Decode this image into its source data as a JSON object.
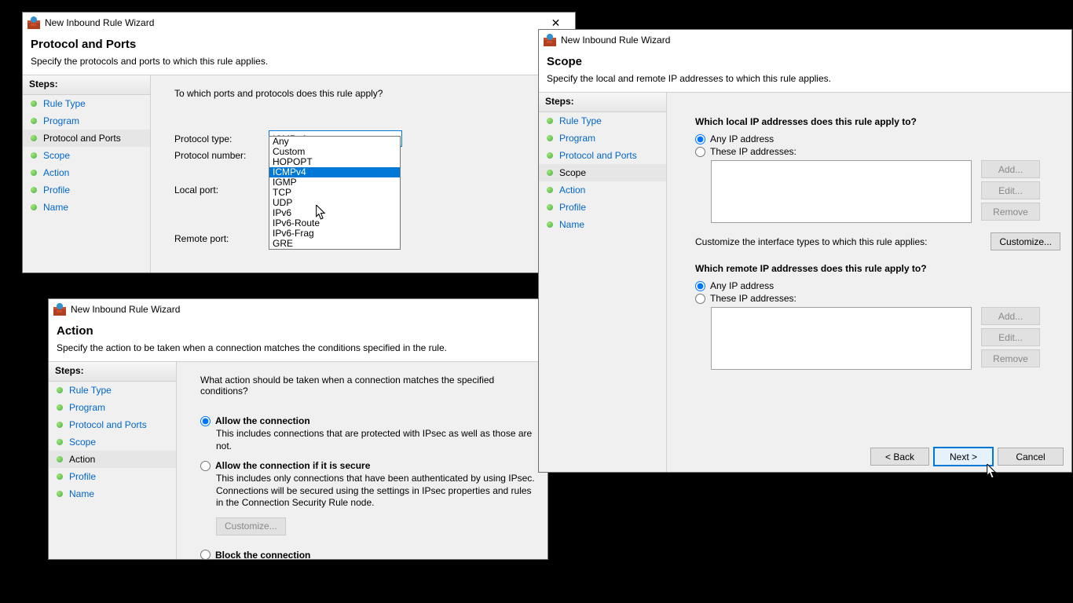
{
  "wizard_title": "New Inbound Rule Wizard",
  "steps_header": "Steps:",
  "steps": [
    "Rule Type",
    "Program",
    "Protocol and Ports",
    "Scope",
    "Action",
    "Profile",
    "Name"
  ],
  "win1": {
    "page_title": "Protocol and Ports",
    "page_subtitle": "Specify the protocols and ports to which this rule applies.",
    "current_step": "Protocol and Ports",
    "prompt": "To which ports and protocols does this rule apply?",
    "protocol_type_label": "Protocol type:",
    "protocol_type_value": "ICMPv4",
    "protocol_number_label": "Protocol number:",
    "local_port_label": "Local port:",
    "remote_port_label": "Remote port:",
    "dropdown_options": [
      "Any",
      "Custom",
      "HOPOPT",
      "ICMPv4",
      "IGMP",
      "TCP",
      "UDP",
      "IPv6",
      "IPv6-Route",
      "IPv6-Frag",
      "GRE"
    ],
    "dropdown_highlight": "ICMPv4"
  },
  "win2": {
    "page_title": "Action",
    "page_subtitle": "Specify the action to be taken when a connection matches the conditions specified in the rule.",
    "current_step": "Action",
    "prompt": "What action should be taken when a connection matches the specified conditions?",
    "opt_allow": "Allow the connection",
    "opt_allow_desc": "This includes connections that are protected with IPsec as well as those are not.",
    "opt_secure": "Allow the connection if it is secure",
    "opt_secure_desc": "This includes only connections that have been authenticated by using IPsec. Connections will be secured using the settings in IPsec properties and rules in the Connection Security Rule node.",
    "customize": "Customize...",
    "opt_block": "Block the connection"
  },
  "win3": {
    "page_title": "Scope",
    "page_subtitle": "Specify the local and remote IP addresses to which this rule applies.",
    "current_step": "Scope",
    "local_prompt": "Which local IP addresses does this rule apply to?",
    "remote_prompt": "Which remote IP addresses does this rule apply to?",
    "opt_any": "Any IP address",
    "opt_these": "These IP addresses:",
    "add": "Add...",
    "edit": "Edit...",
    "remove": "Remove",
    "iface_label": "Customize the interface types to which this rule applies:",
    "customize": "Customize...",
    "back": "< Back",
    "next": "Next >",
    "cancel": "Cancel"
  }
}
